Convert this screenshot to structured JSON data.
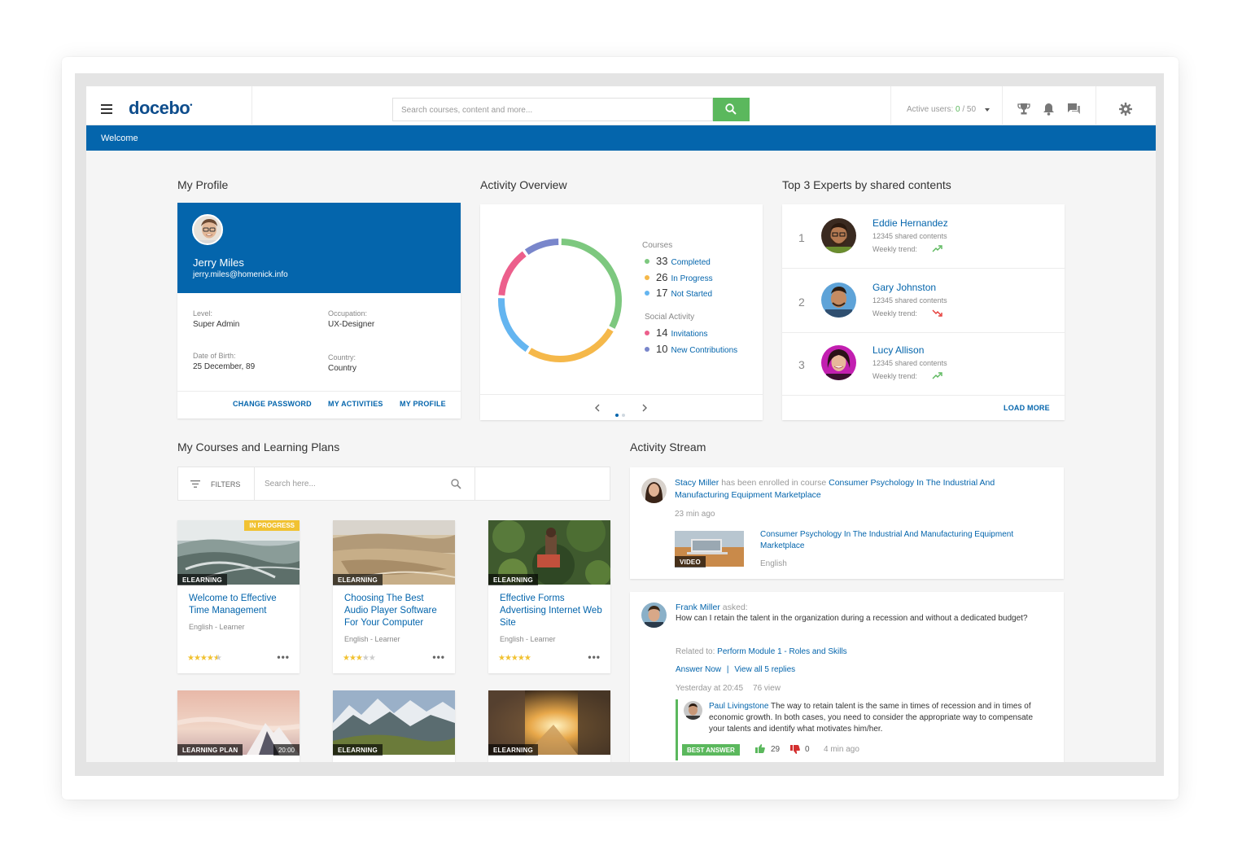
{
  "header": {
    "logo": "docebo",
    "logo_mark": "•",
    "search_placeholder": "Search courses, content and more...",
    "active_users_label": "Active users:",
    "active_users_value": "0",
    "active_users_max": "/ 50"
  },
  "nav": {
    "welcome": "Welcome"
  },
  "profile": {
    "section_title": "My Profile",
    "name": "Jerry Miles",
    "email": "jerry.miles@homenick.info",
    "fields": [
      {
        "label": "Level:",
        "value": "Super Admin"
      },
      {
        "label": "Occupation:",
        "value": "UX-Designer"
      },
      {
        "label": "Date of Birth:",
        "value": "25 December, 89"
      },
      {
        "label": "Country:",
        "value": "Country"
      }
    ],
    "links": [
      "CHANGE PASSWORD",
      "MY ACTIVITIES",
      "MY PROFILE"
    ]
  },
  "activity": {
    "section_title": "Activity Overview",
    "courses_title": "Courses",
    "courses": [
      {
        "count": "33",
        "label": "Completed",
        "color": "#7dc87f"
      },
      {
        "count": "26",
        "label": "In Progress",
        "color": "#f5b84a"
      },
      {
        "count": "17",
        "label": "Not Started",
        "color": "#64b5f0"
      }
    ],
    "social_title": "Social Activity",
    "social": [
      {
        "count": "14",
        "label": "Invitations",
        "color": "#ec5f8c"
      },
      {
        "count": "10",
        "label": "New Contributions",
        "color": "#7986cb"
      }
    ],
    "pager": {
      "total": 2,
      "current": 1
    }
  },
  "experts": {
    "section_title": "Top 3 Experts by shared contents",
    "trend_label": "Weekly trend:",
    "items": [
      {
        "rank": "1",
        "name": "Eddie Hernandez",
        "shared": "12345 shared contents",
        "trend": "up"
      },
      {
        "rank": "2",
        "name": "Gary Johnston",
        "shared": "12345 shared contents",
        "trend": "down"
      },
      {
        "rank": "3",
        "name": "Lucy Allison",
        "shared": "12345 shared contents",
        "trend": "up"
      }
    ],
    "load_more": "LOAD MORE"
  },
  "courses": {
    "section_title": "My Courses and Learning Plans",
    "filters": "FILTERS",
    "search_placeholder": "Search here...",
    "items": [
      {
        "title": "Welcome to Effective Time Management",
        "meta": "English - Learner",
        "type": "ELEARNING",
        "status": "IN PROGRESS",
        "rating": 4.5
      },
      {
        "title": "Choosing The Best Audio Player Software For Your Computer",
        "meta": "English - Learner",
        "type": "ELEARNING",
        "rating": 3
      },
      {
        "title": "Effective Forms Advertising Internet Web Site",
        "meta": "English - Learner",
        "type": "ELEARNING",
        "rating": 5
      },
      {
        "type": "LEARNING PLAN",
        "duration": "20:00"
      },
      {
        "type": "ELEARNING"
      },
      {
        "type": "ELEARNING"
      }
    ]
  },
  "stream": {
    "section_title": "Activity Stream",
    "post1": {
      "user": "Stacy Miller",
      "action": "has been enrolled in course",
      "course": "Consumer Psychology In The Industrial And Manufacturing Equipment Marketplace",
      "time": "23 min ago",
      "media_badge": "VIDEO",
      "media_title": "Consumer Psychology In The Industrial And Manufacturing Equipment Marketplace",
      "media_lang": "English"
    },
    "post2": {
      "user": "Frank Miller",
      "action": "asked:",
      "question": "How can I retain the talent in the organization during a recession and without a dedicated budget?",
      "related_label": "Related to:",
      "related": "Perform Module 1 - Roles and Skills",
      "answer_now": "Answer Now",
      "sep": "|",
      "view_replies": "View all 5 replies",
      "time": "Yesterday at 20:45",
      "views": "76 view",
      "reply_user": "Paul Livingstone",
      "reply_text": "The way to retain talent is the same in times of recession and in times of economic growth. In both cases, you need to consider the appropriate way to compensate your talents and identify what motivates him/her.",
      "best_answer": "BEST ANSWER",
      "likes": "29",
      "dislikes": "0",
      "reply_time": "4 min ago"
    }
  }
}
